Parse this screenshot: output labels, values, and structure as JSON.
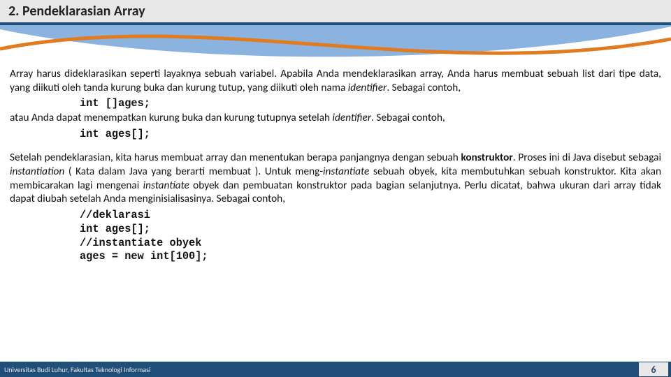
{
  "title": "2.  Pendeklarasian Array",
  "p1a": "Array harus dideklarasikan seperti layaknya sebuah variabel. Apabila Anda mendeklarasikan array, Anda harus membuat sebuah list dari tipe data, yang diikuti oleh tanda kurung buka dan kurung tutup, yang diikuti oleh nama ",
  "p1_i1": "identifier",
  "p1b": ". Sebagai contoh,",
  "code1": "int []ages;",
  "p2a": "atau Anda dapat menempatkan kurung buka dan kurung tutupnya setelah ",
  "p2_i1": "identifier",
  "p2b": ". Sebagai contoh,",
  "code2": "int ages[];",
  "p3a": "Setelah pendeklarasian, kita harus membuat array dan menentukan berapa panjangnya dengan sebuah ",
  "p3_b1": "konstruktor",
  "p3b": ". Proses ini di Java disebut sebagai ",
  "p3_i1": "instantiation",
  "p3c": " ( Kata dalam Java yang berarti membuat ). Untuk meng-",
  "p3_i2": "instantiate",
  "p3d": " sebuah obyek, kita membutuhkan sebuah konstruktor. Kita akan membicarakan lagi mengenai ",
  "p3_i3": "instantiate",
  "p3e": " obyek dan pembuatan konstruktor pada bagian selanjutnya. Perlu dicatat, bahwa ukuran dari array tidak dapat diubah setelah Anda menginisialisasinya. Sebagai contoh,",
  "code3": "//deklarasi",
  "code4": "int ages[];",
  "code5": "//instantiate obyek",
  "code6": "ages = new int[100];",
  "footer": "Universitas Budi Luhur, Fakultas Teknologi Informasi",
  "page": "6"
}
